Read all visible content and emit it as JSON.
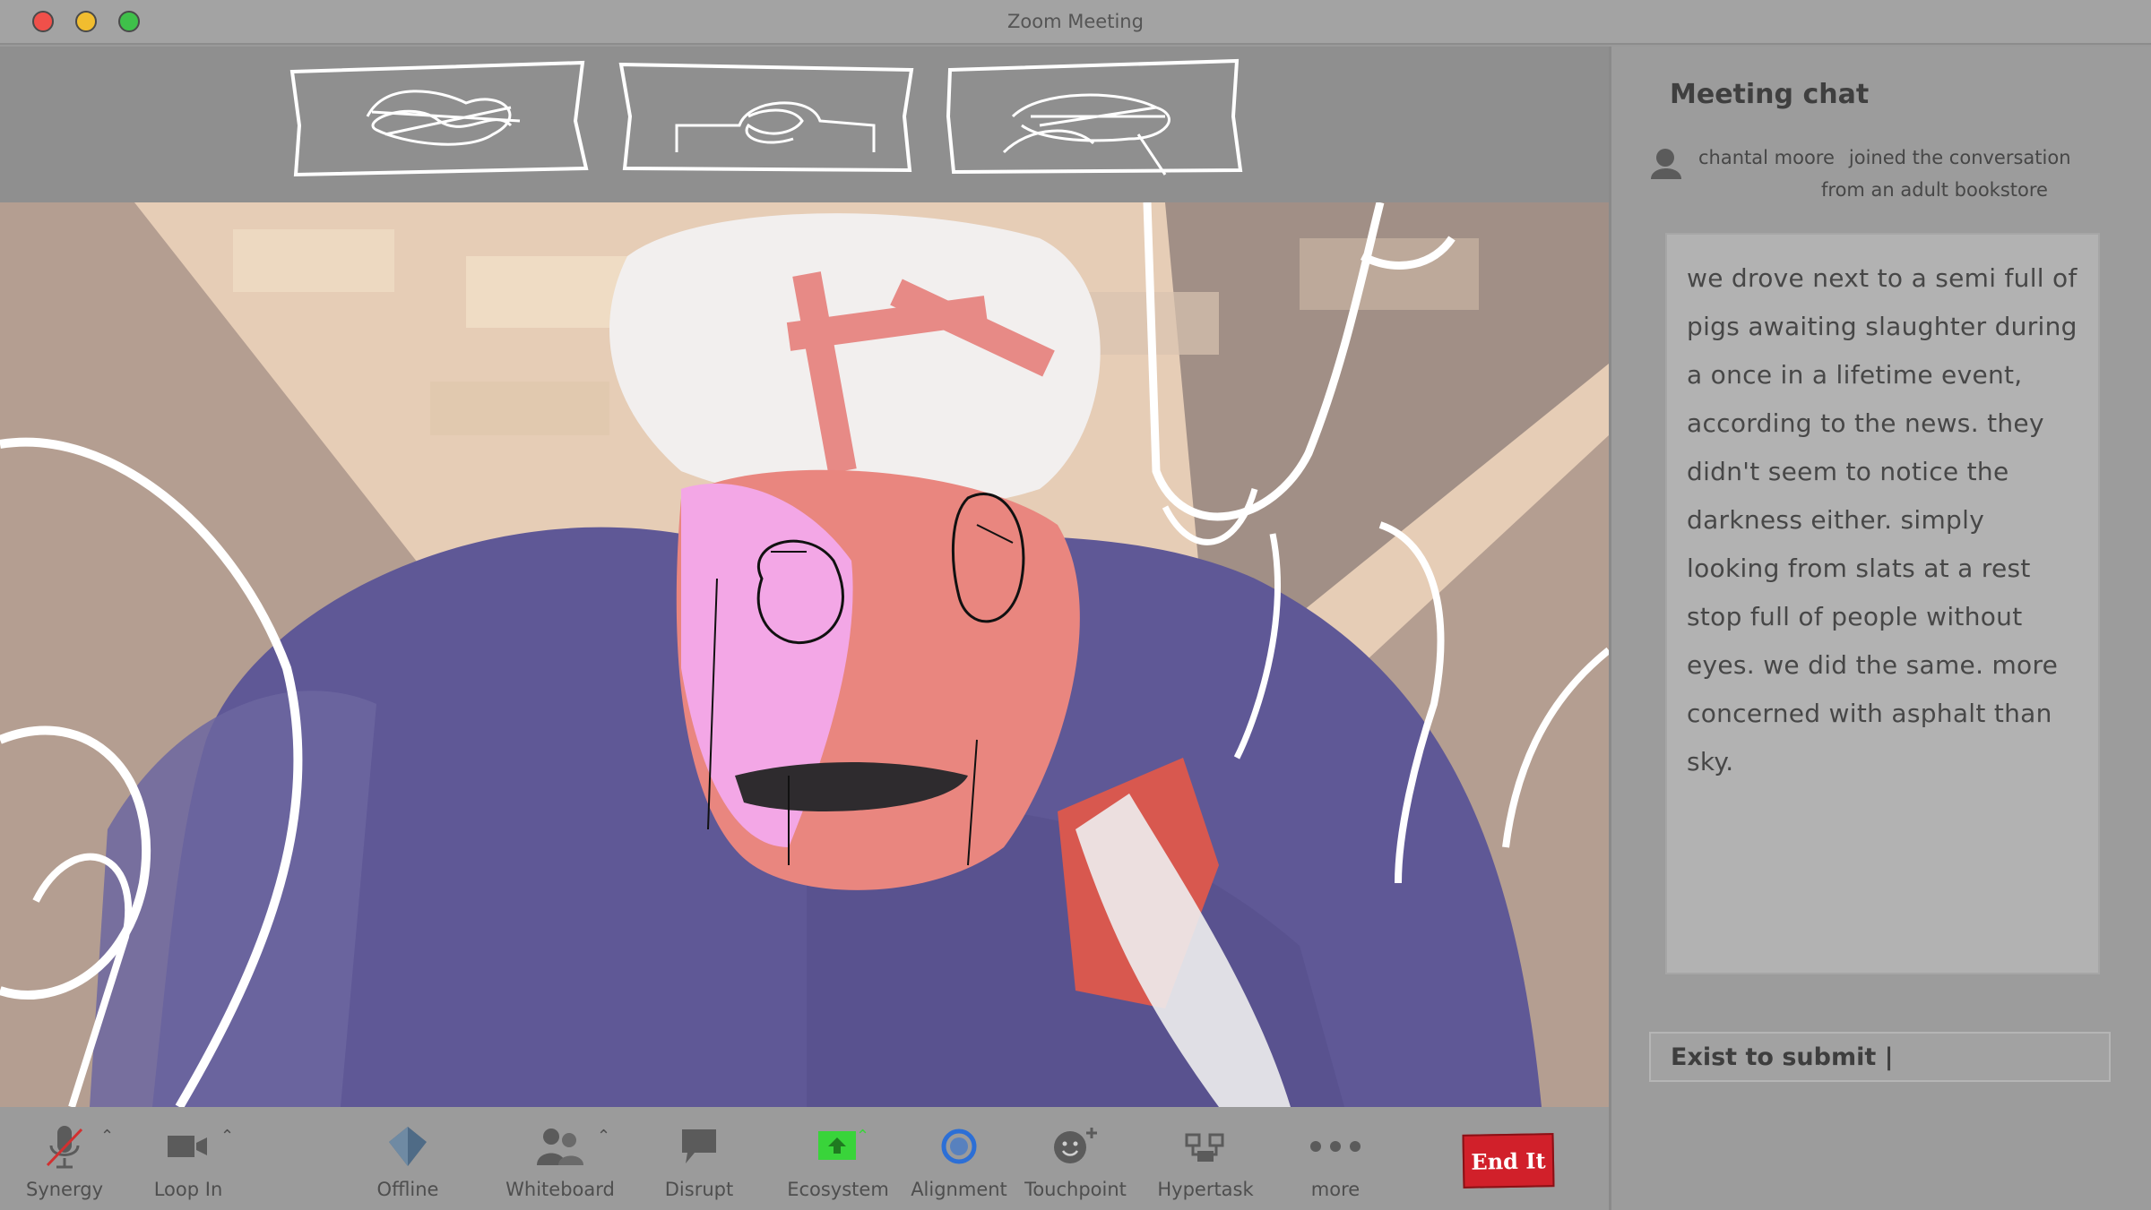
{
  "window": {
    "title": "Zoom Meeting"
  },
  "chat": {
    "title": "Meeting chat",
    "join_name": "chantal moore",
    "join_line1": "joined the conversation",
    "join_line2": "from an adult bookstore",
    "message": "we drove next to a semi full of pigs awaiting slaughter during a once in a lifetime event, according to the news. they didn't seem to notice the darkness either. simply looking from slats at a rest stop full of people without eyes. we did the same. more concerned with asphalt than sky.",
    "input_placeholder": "Exist to submit |"
  },
  "toolbar": {
    "synergy": "Synergy",
    "loop_in": "Loop In",
    "offline": "Offline",
    "whiteboard": "Whiteboard",
    "disrupt": "Disrupt",
    "ecosystem": "Ecosystem",
    "alignment": "Alignment",
    "touchpoint": "Touchpoint",
    "hypertask": "Hypertask",
    "more": "more",
    "end": "End It"
  },
  "colors": {
    "end_button": "#d1202a",
    "ecosystem_icon": "#39d43a",
    "alignment_icon": "#2c6fd6"
  }
}
